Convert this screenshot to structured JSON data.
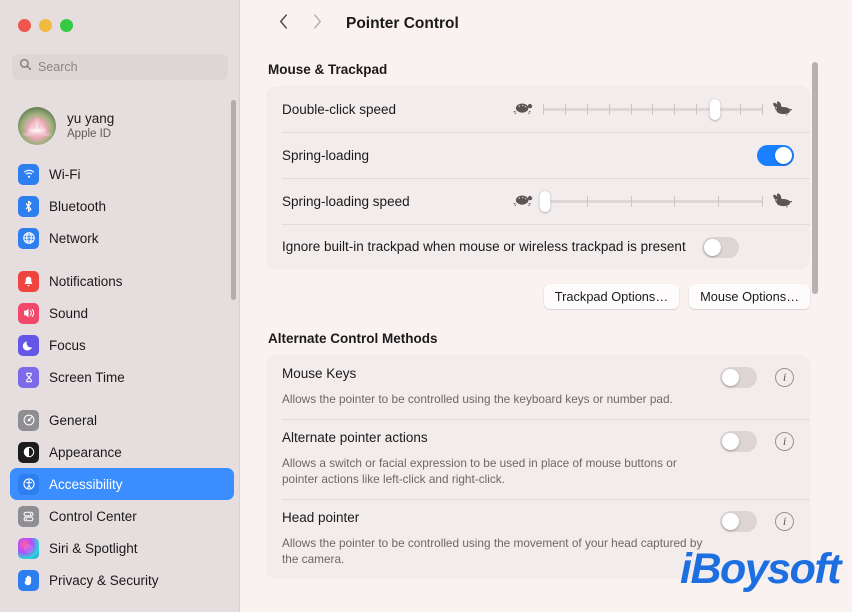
{
  "window": {
    "traffic_lights": [
      "close",
      "minimize",
      "maximize"
    ],
    "colors": {
      "accent_blue": "#3a8eff",
      "toggle_on": "#1a80ff",
      "sidebar_bg": "#e6dede",
      "main_bg": "#faf1f1",
      "card_bg": "#f3ecec",
      "watermark_blue": "#1d6fe0"
    }
  },
  "sidebar": {
    "search": {
      "placeholder": "Search",
      "value": "",
      "icon": "search-icon"
    },
    "account": {
      "name": "yu yang",
      "subtitle": "Apple ID",
      "avatar": "lotus-flower-avatar"
    },
    "groups": [
      {
        "items": [
          {
            "label": "Wi-Fi",
            "icon": "wifi-icon",
            "selected": false
          },
          {
            "label": "Bluetooth",
            "icon": "bluetooth-icon",
            "selected": false
          },
          {
            "label": "Network",
            "icon": "network-globe-icon",
            "selected": false
          }
        ]
      },
      {
        "items": [
          {
            "label": "Notifications",
            "icon": "notifications-bell-icon",
            "selected": false
          },
          {
            "label": "Sound",
            "icon": "sound-speaker-icon",
            "selected": false
          },
          {
            "label": "Focus",
            "icon": "focus-moon-icon",
            "selected": false
          },
          {
            "label": "Screen Time",
            "icon": "screen-time-hourglass-icon",
            "selected": false
          }
        ]
      },
      {
        "items": [
          {
            "label": "General",
            "icon": "general-gear-icon",
            "selected": false
          },
          {
            "label": "Appearance",
            "icon": "appearance-contrast-icon",
            "selected": false
          },
          {
            "label": "Accessibility",
            "icon": "accessibility-person-icon",
            "selected": true
          },
          {
            "label": "Control Center",
            "icon": "control-center-icon",
            "selected": false
          },
          {
            "label": "Siri & Spotlight",
            "icon": "siri-icon",
            "selected": false
          },
          {
            "label": "Privacy & Security",
            "icon": "privacy-hand-icon",
            "selected": false
          }
        ]
      }
    ]
  },
  "toolbar": {
    "back_icon": "chevron-left-icon",
    "forward_icon": "chevron-right-icon",
    "title": "Pointer Control"
  },
  "main": {
    "sections": [
      {
        "title": "Mouse & Trackpad",
        "rows": [
          {
            "type": "slider",
            "label": "Double-click speed",
            "left_icon": "turtle-icon",
            "right_icon": "rabbit-icon",
            "ticks": 11,
            "value_percent": 78
          },
          {
            "type": "toggle",
            "label": "Spring-loading",
            "enabled": true
          },
          {
            "type": "slider",
            "label": "Spring-loading speed",
            "left_icon": "turtle-icon",
            "right_icon": "rabbit-icon",
            "ticks": 6,
            "value_percent": 1
          },
          {
            "type": "toggle",
            "label": "Ignore built-in trackpad when mouse or wireless trackpad is present",
            "enabled": false,
            "multiline": true
          }
        ],
        "buttons": [
          {
            "label": "Trackpad Options…"
          },
          {
            "label": "Mouse Options…"
          }
        ]
      },
      {
        "title": "Alternate Control Methods",
        "description_rows": [
          {
            "title": "Mouse Keys",
            "description": "Allows the pointer to be controlled using the keyboard keys or number pad.",
            "enabled": false,
            "info_icon": "info-circle-icon"
          },
          {
            "title": "Alternate pointer actions",
            "description": "Allows a switch or facial expression to be used in place of mouse buttons or pointer actions like left-click and right-click.",
            "enabled": false,
            "info_icon": "info-circle-icon"
          },
          {
            "title": "Head pointer",
            "description": "Allows the pointer to be controlled using the movement of your head captured by the camera.",
            "enabled": false,
            "info_icon": "info-circle-icon"
          }
        ]
      }
    ]
  },
  "watermark": {
    "text": "iBoysoft"
  }
}
